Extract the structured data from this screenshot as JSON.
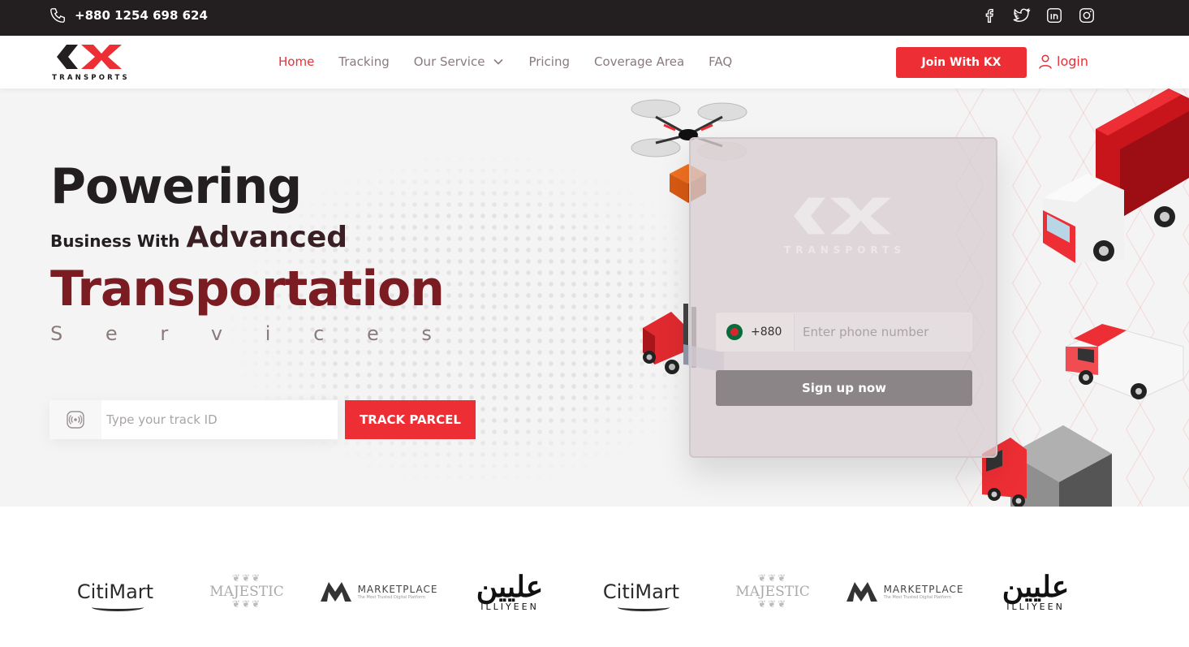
{
  "topbar": {
    "phone": "+880 1254 698 624",
    "social": [
      "facebook-icon",
      "twitter-icon",
      "linkedin-icon",
      "instagram-icon"
    ]
  },
  "brand": {
    "name": "TRANSPORTS",
    "accent": "#ee2e35",
    "dark": "#231f20"
  },
  "nav": {
    "items": [
      {
        "label": "Home",
        "active": true
      },
      {
        "label": "Tracking"
      },
      {
        "label": "Our Service",
        "dropdown": true
      },
      {
        "label": "Pricing"
      },
      {
        "label": "Coverage Area"
      },
      {
        "label": "FAQ"
      }
    ],
    "join_label": "Join With KX",
    "login_label": "login"
  },
  "hero": {
    "line1": "Powering",
    "line2_small": "Business With",
    "line2_big": "Advanced",
    "line3": "Transportation",
    "line4_letters": [
      "S",
      "e",
      "r",
      "v",
      "i",
      "c",
      "e",
      "s"
    ],
    "track": {
      "placeholder": "Type your track ID",
      "button": "TRACK PARCEL"
    }
  },
  "signup": {
    "brand": "TRANSPORTS",
    "country_code": "+880",
    "phone_placeholder": "Enter phone number",
    "button": "Sign up now"
  },
  "partners": [
    {
      "type": "citimart",
      "name": "CitiMart"
    },
    {
      "type": "majestic",
      "name": "MAJESTIC"
    },
    {
      "type": "marketplace",
      "name": "MARKETPLACE",
      "tagline": "The Most Trusted Digital Platform"
    },
    {
      "type": "illiyeen",
      "arabic": "عليين",
      "name": "ILLIYEEN"
    },
    {
      "type": "citimart",
      "name": "CitiMart"
    },
    {
      "type": "majestic",
      "name": "MAJESTIC"
    },
    {
      "type": "marketplace",
      "name": "MARKETPLACE",
      "tagline": "The Most Trusted Digital Platform"
    },
    {
      "type": "illiyeen",
      "arabic": "عليين",
      "name": "ILLIYEEN"
    }
  ]
}
